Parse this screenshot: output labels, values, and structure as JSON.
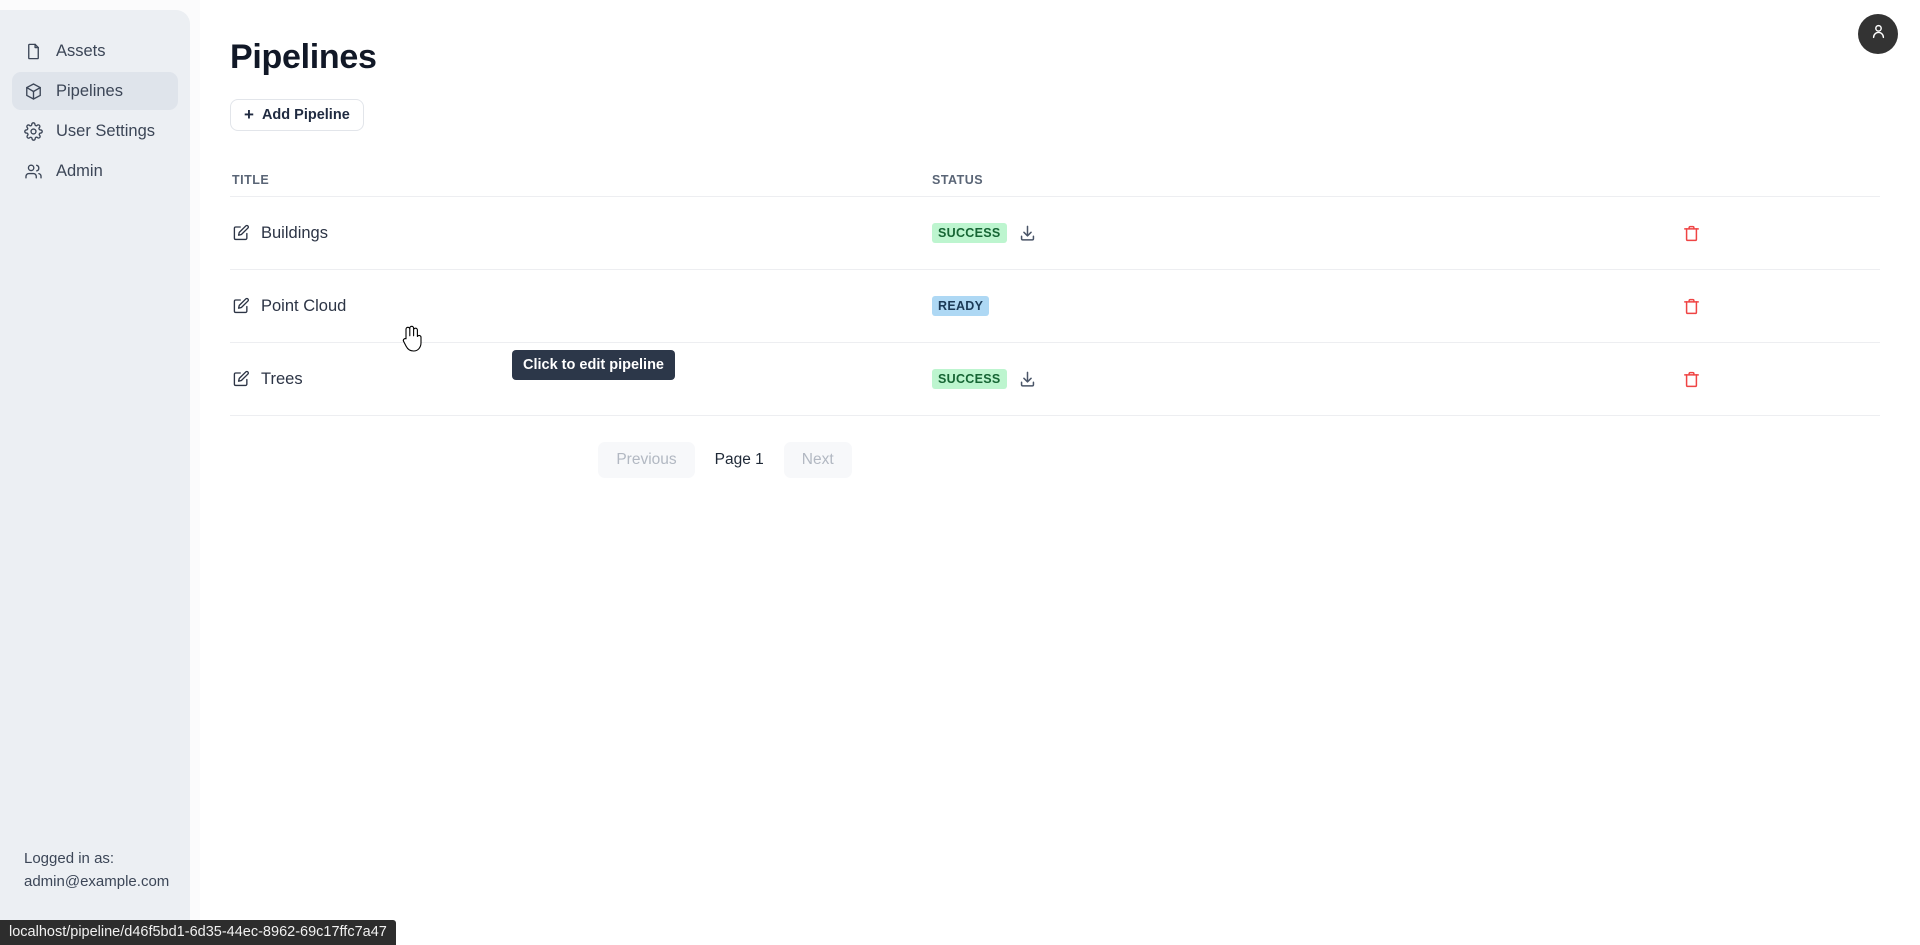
{
  "sidebar": {
    "items": [
      {
        "label": "Assets",
        "icon": "file-icon",
        "active": false
      },
      {
        "label": "Pipelines",
        "icon": "box-icon",
        "active": true
      },
      {
        "label": "User Settings",
        "icon": "gear-icon",
        "active": false
      },
      {
        "label": "Admin",
        "icon": "users-icon",
        "active": false
      }
    ],
    "footer": {
      "logged_in_label": "Logged in as:",
      "user_email": "admin@example.com"
    }
  },
  "header": {
    "title": "Pipelines",
    "avatar_icon": "user-icon"
  },
  "toolbar": {
    "add_label": "Add Pipeline",
    "add_icon": "plus-icon"
  },
  "table": {
    "columns": [
      "TITLE",
      "STATUS",
      ""
    ],
    "rows": [
      {
        "title": "Buildings",
        "edit_icon": "edit-icon",
        "status": "SUCCESS",
        "status_type": "success",
        "has_download": true,
        "download_icon": "download-icon",
        "delete_icon": "trash-icon"
      },
      {
        "title": "Point Cloud",
        "edit_icon": "edit-icon",
        "status": "READY",
        "status_type": "ready",
        "has_download": false,
        "download_icon": "download-icon",
        "delete_icon": "trash-icon"
      },
      {
        "title": "Trees",
        "edit_icon": "edit-icon",
        "status": "SUCCESS",
        "status_type": "success",
        "has_download": true,
        "download_icon": "download-icon",
        "delete_icon": "trash-icon"
      }
    ]
  },
  "pagination": {
    "previous_label": "Previous",
    "page_label": "Page 1",
    "next_label": "Next"
  },
  "tooltip": {
    "text": "Click to edit pipeline"
  },
  "statusbar": {
    "url": "localhost/pipeline/d46f5bd1-6d35-44ec-8962-69c17ffc7a47"
  },
  "colors": {
    "sidebar_bg": "#eceff3",
    "sidebar_active": "#dfe4eb",
    "success_bg": "#bdf5cf",
    "success_text": "#166534",
    "ready_bg": "#aed8f4",
    "ready_text": "#1b3a57",
    "danger": "#ef4444",
    "tooltip_bg": "#2c3749",
    "avatar_bg": "#333333"
  }
}
